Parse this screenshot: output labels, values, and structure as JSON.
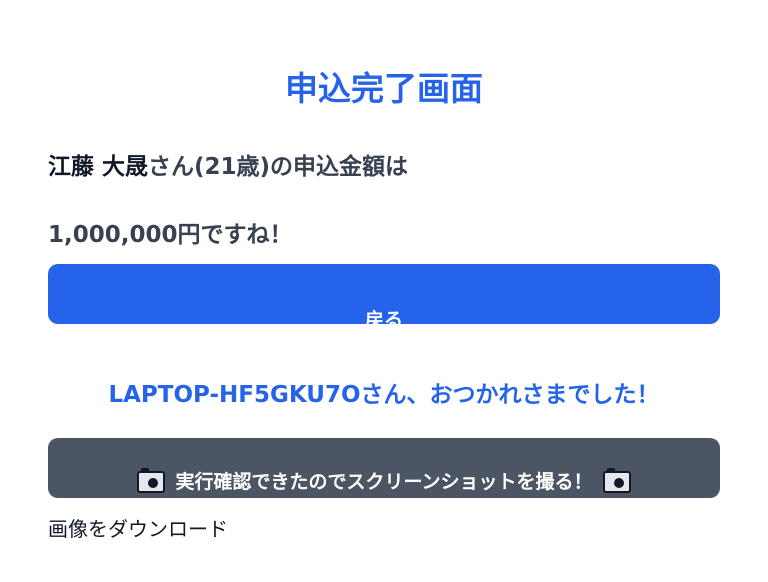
{
  "page": {
    "title": "申込完了画面"
  },
  "summary": {
    "name": "江藤 大晟",
    "suffix_age": "さん(21歳)の申込金額は",
    "amount_line": "1,000,000円ですね！"
  },
  "buttons": {
    "back_label": "戻る",
    "screenshot_label": "実行確認できたのでスクリーンショットを撮る！"
  },
  "greeting": {
    "text": "LAPTOP-HF5GKU7Oさん、おつかれさまでした！"
  },
  "download": {
    "label": "画像をダウンロード"
  },
  "icons": {
    "screenshot_left": "camera-icon",
    "screenshot_right": "camera-icon"
  },
  "colors": {
    "accent": "#2563eb",
    "secondary_button": "#4b5563",
    "text": "#374151"
  }
}
